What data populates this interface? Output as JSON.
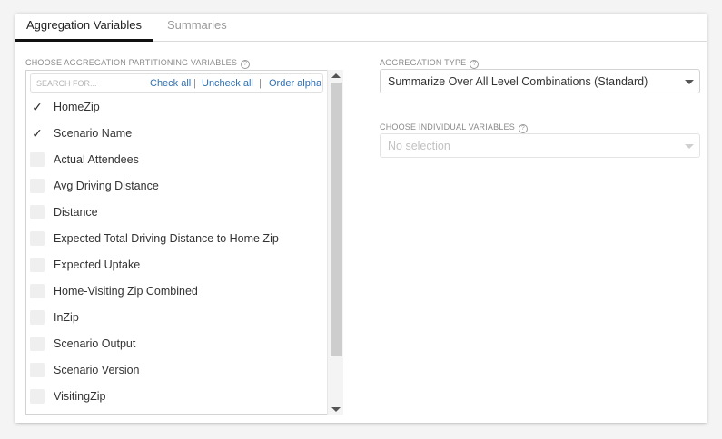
{
  "tabs": [
    {
      "label": "Aggregation Variables",
      "active": true
    },
    {
      "label": "Summaries",
      "active": false
    }
  ],
  "partitioning": {
    "section_label": "CHOOSE AGGREGATION PARTITIONING VARIABLES",
    "help_icon": "?",
    "search_placeholder": "SEARCH FOR...",
    "check_all": "Check all",
    "uncheck_all": "Uncheck all",
    "separator": "|",
    "order_alpha": "Order alpha",
    "items": [
      {
        "label": "HomeZip",
        "checked": true,
        "mark": "✓"
      },
      {
        "label": "Scenario Name",
        "checked": true,
        "mark": "✓"
      },
      {
        "label": "Actual Attendees",
        "checked": false,
        "mark": ""
      },
      {
        "label": "Avg Driving Distance",
        "checked": false,
        "mark": ""
      },
      {
        "label": "Distance",
        "checked": false,
        "mark": ""
      },
      {
        "label": "Expected Total Driving Distance to Home Zip",
        "checked": false,
        "mark": ""
      },
      {
        "label": "Expected Uptake",
        "checked": false,
        "mark": ""
      },
      {
        "label": "Home-Visiting Zip Combined",
        "checked": false,
        "mark": ""
      },
      {
        "label": "InZip",
        "checked": false,
        "mark": ""
      },
      {
        "label": "Scenario Output",
        "checked": false,
        "mark": ""
      },
      {
        "label": "Scenario Version",
        "checked": false,
        "mark": ""
      },
      {
        "label": "VisitingZip",
        "checked": false,
        "mark": ""
      }
    ]
  },
  "aggregation_type": {
    "section_label": "AGGREGATION TYPE",
    "help_icon": "?",
    "value": "Summarize Over All Level Combinations (Standard)"
  },
  "individual_variables": {
    "section_label": "CHOOSE INDIVIDUAL VARIABLES",
    "help_icon": "?",
    "value": "No selection",
    "disabled": true
  }
}
